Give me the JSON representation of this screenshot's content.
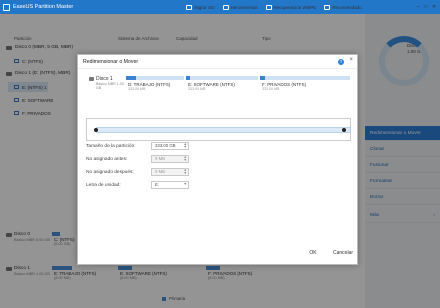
{
  "app": {
    "title": "EaseUS Partition Master"
  },
  "toolbar": {
    "actions": [
      {
        "label": "Migrar SO",
        "icon": "migrate-os-icon"
      },
      {
        "label": "Herramientas",
        "icon": "tools-icon"
      },
      {
        "label": "Recuperación WinPE",
        "icon": "winpe-icon"
      },
      {
        "label": "Recomendado",
        "icon": "recommend-icon"
      }
    ]
  },
  "columns": [
    "Partición",
    "Sistema de Archivos",
    "Capacidad",
    "Tipo"
  ],
  "left_tree": {
    "disk0": "Disco 0 (MBR, 5 GB, MBR)",
    "disk0_part": "C: (NTFS)",
    "disk1": "Disco 1 (E: (NTFS), MBR)",
    "disk1_parts": [
      "E: (NTFS) 1",
      "E: SOFTWARE",
      "F: PRIVADOS"
    ]
  },
  "right_panel": {
    "disk_label": "Disco 1",
    "disk_sub": "1.00 GB",
    "items": [
      {
        "label": "Redimensionar o Mover",
        "active": true
      },
      {
        "label": "Clonar",
        "active": false
      },
      {
        "label": "Fusionar",
        "active": false
      },
      {
        "label": "Formatear",
        "active": false
      },
      {
        "label": "Borrar",
        "active": false
      },
      {
        "label": "Más",
        "active": false
      }
    ]
  },
  "bottom_disks": [
    {
      "name": "Disco 0",
      "sub": "Básico MBR\n5.00 GB",
      "segments": [
        {
          "label": "C: (NTFS)",
          "sub": "(5.00 GB)",
          "fill": 1.0
        }
      ]
    },
    {
      "name": "Disco 1",
      "sub": "Básico MBR\n1.00 GB",
      "segments": [
        {
          "label": "E: TRABAJO (NTFS)",
          "sub": "(8.00 MB)",
          "fill": 0.3
        },
        {
          "label": "E: SOFTWARE (NTFS)",
          "sub": "(8.00 MB)",
          "fill": 0.2
        },
        {
          "label": "F: PRIVADOS (NTFS)",
          "sub": "(8.00 MB)",
          "fill": 0.15
        }
      ]
    }
  ],
  "legend": {
    "label": "Primaria",
    "color": "#4a8fd8"
  },
  "dialog": {
    "title": "Redimensionar o Mover",
    "disk_name": "Disco 1",
    "disk_sub": "Básico MBR\n1.00 GB",
    "partitions": [
      {
        "label": "D: TRABAJO (NTFS)",
        "sub": "333.00 MB",
        "fill": 0.18
      },
      {
        "label": "E: SOFTWARE (NTFS)",
        "sub": "333.00 MB",
        "fill": 0.06
      },
      {
        "label": "F: PRIVADOS (NTFS)",
        "sub": "333.00 MB",
        "fill": 0.05
      }
    ],
    "slider_position": 0.0,
    "fields": [
      {
        "label": "Tamaño de la partición:",
        "value": "333.00 GB",
        "disabled": false
      },
      {
        "label": "No asignado antes:",
        "value": "0 MB",
        "disabled": true
      },
      {
        "label": "No asignado después:",
        "value": "0 MB",
        "disabled": true
      },
      {
        "label": "Letra de unidad:",
        "value": "E:",
        "disabled": false
      }
    ],
    "ok_label": "OK",
    "cancel_label": "Cancelar"
  }
}
